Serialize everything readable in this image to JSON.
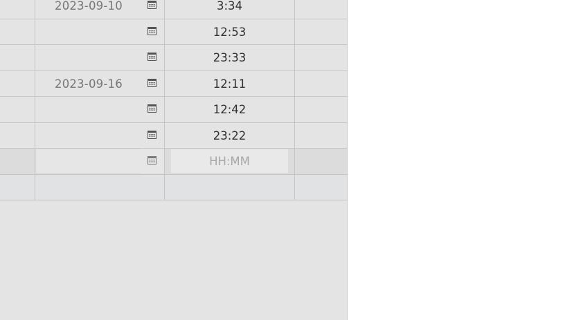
{
  "rows": [
    {
      "date": "2023-09-10",
      "time": "3:34"
    },
    {
      "date": "",
      "time": "12:53"
    },
    {
      "date": "",
      "time": "23:33"
    },
    {
      "date": "2023-09-16",
      "time": "12:11"
    },
    {
      "date": "",
      "time": "12:42"
    },
    {
      "date": "",
      "time": "23:22"
    }
  ],
  "new_row": {
    "time_placeholder": "HH:MM"
  },
  "icons": {
    "calendar": "calendar-icon"
  },
  "colors": {
    "panel_bg": "#e4e4e4",
    "grid_line": "#c4c4c4",
    "text": "#2f2f2f",
    "muted_text": "#777777",
    "placeholder": "#a8a8a8"
  }
}
